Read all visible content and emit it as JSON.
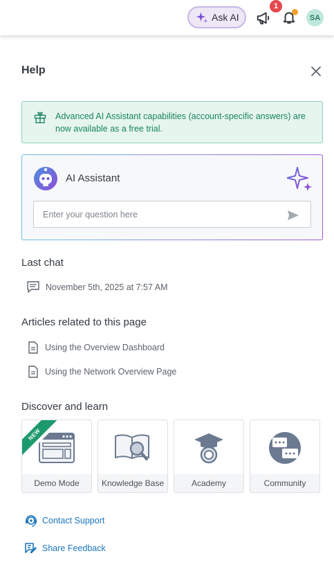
{
  "topbar": {
    "ask_ai_label": "Ask AI",
    "notification_count": "1",
    "avatar_initials": "SA"
  },
  "panel": {
    "title": "Help",
    "banner_text": "Advanced AI Assistant capabilities (account-specific answers) are now available as a free trial."
  },
  "ai_assistant": {
    "title": "AI Assistant",
    "input_placeholder": "Enter your question here",
    "input_value": ""
  },
  "last_chat": {
    "heading": "Last chat",
    "item": "November 5th, 2025 at 7:57 AM"
  },
  "articles": {
    "heading": "Articles related to this page",
    "items": [
      "Using the Overview Dashboard",
      "Using the Network Overview Page"
    ]
  },
  "discover": {
    "heading": "Discover and learn",
    "tiles": [
      {
        "label": "Demo Mode",
        "badge": "NEW",
        "icon": "demo-window-icon"
      },
      {
        "label": "Knowledge Base",
        "icon": "book-magnifier-icon"
      },
      {
        "label": "Academy",
        "icon": "graduation-cap-icon"
      },
      {
        "label": "Community",
        "icon": "chat-bubbles-icon"
      }
    ]
  },
  "links": {
    "contact_support": "Contact Support",
    "share_feedback": "Share Feedback"
  },
  "colors": {
    "banner_green": "#17855b",
    "link_blue": "#1c75bc",
    "ai_purple": "#7b4fd0",
    "badge_red": "#e5484d"
  }
}
